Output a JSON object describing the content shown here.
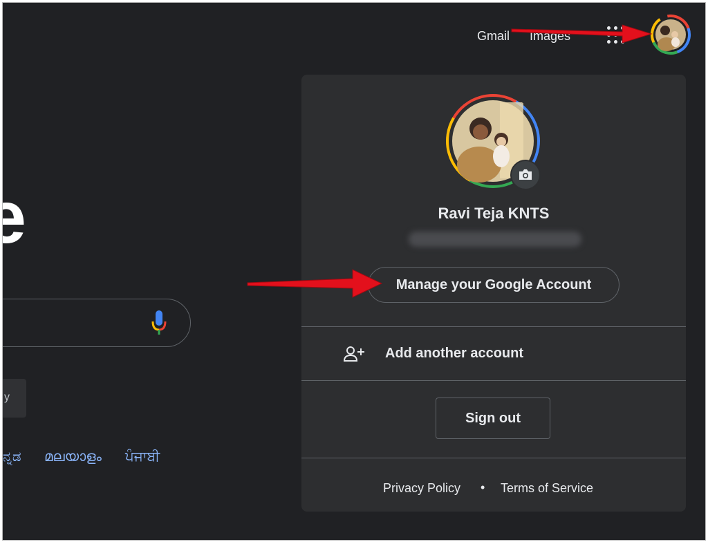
{
  "header": {
    "gmail_label": "Gmail",
    "images_label": "Images",
    "apps_icon": "apps-grid-icon",
    "avatar_icon": "account-avatar-icon"
  },
  "search": {
    "logo_fragment": "e",
    "mic_icon": "microphone-icon",
    "lucky_fragment": "y"
  },
  "languages": [
    {
      "label": "ನ್ನಡ"
    },
    {
      "label": "മലയാളം"
    },
    {
      "label": "ਪੰਜਾਬੀ"
    }
  ],
  "account_panel": {
    "user_name": "Ravi Teja KNTS",
    "manage_label": "Manage your Google Account",
    "add_account_label": "Add another account",
    "add_account_icon": "add-person-icon",
    "camera_icon": "camera-icon",
    "sign_out_label": "Sign out",
    "footer": {
      "privacy_label": "Privacy Policy",
      "separator": "•",
      "terms_label": "Terms of Service"
    }
  },
  "colors": {
    "background": "#202124",
    "panel": "#2d2e30",
    "link_blue": "#8ab4f8",
    "annotation_arrow": "#e3101c",
    "google_red": "#ea4335",
    "google_yellow": "#fbbc05",
    "google_green": "#34a853",
    "google_blue": "#4285f4"
  }
}
